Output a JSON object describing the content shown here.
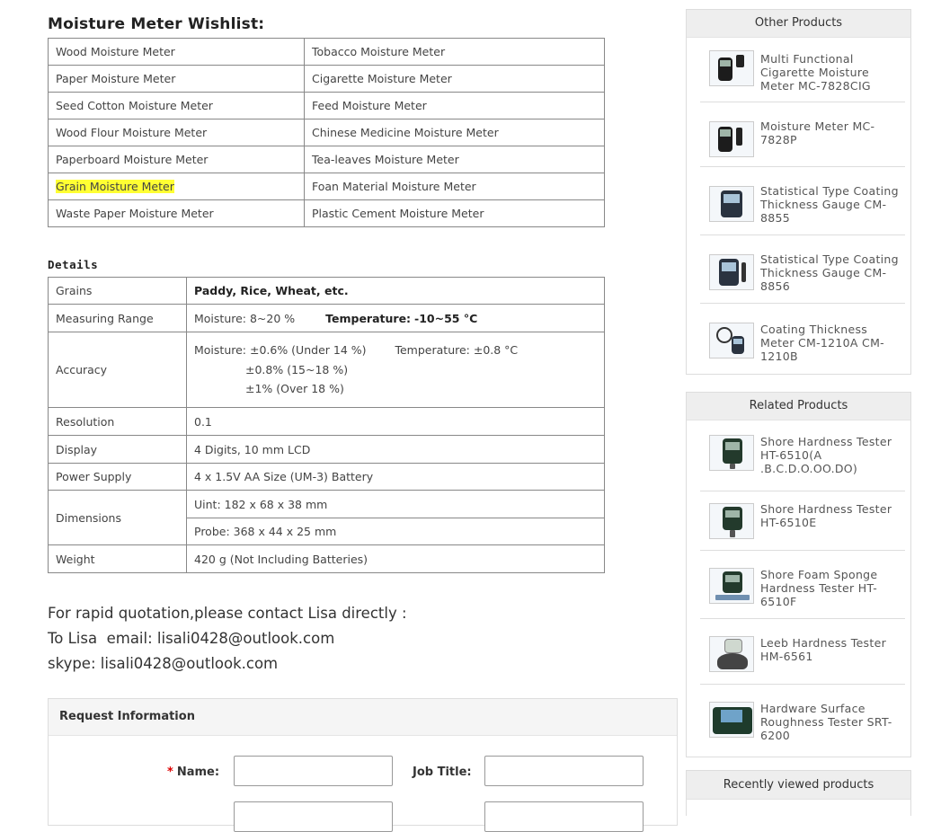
{
  "wishlist": {
    "title": "Moisture Meter Wishlist:",
    "rows": [
      [
        "Wood Moisture Meter",
        "Tobacco Moisture Meter"
      ],
      [
        "Paper Moisture Meter",
        "Cigarette Moisture Meter"
      ],
      [
        "Seed Cotton Moisture Meter",
        "Feed Moisture Meter"
      ],
      [
        "Wood Flour Moisture Meter",
        "Chinese Medicine Moisture Meter"
      ],
      [
        "Paperboard Moisture Meter",
        "Tea-leaves Moisture Meter"
      ],
      [
        "Grain Moisture Meter",
        "Foan Material Moisture Meter"
      ],
      [
        "Waste Paper Moisture Meter",
        "Plastic Cement Moisture Meter"
      ]
    ],
    "highlight_color": "#ffff33"
  },
  "details": {
    "title": "Details",
    "grains_label": "Grains",
    "grains_value": "Paddy, Rice, Wheat, etc.",
    "range_label": "Measuring Range",
    "range_moisture": "Moisture: 8~20 %",
    "range_temp_label": "Temperature:",
    "range_temp_value": "-10~55 °C",
    "accuracy_label": "Accuracy",
    "accuracy_line1": "Moisture: ±0.6% (Under 14 %)",
    "accuracy_temp": "Temperature: ±0.8 °C",
    "accuracy_line2": "±0.8% (15~18 %)",
    "accuracy_line3": "±1% (Over 18 %)",
    "resolution_label": "Resolution",
    "resolution_value": "0.1",
    "display_label": "Display",
    "display_value": "4 Digits, 10 mm LCD",
    "power_label": "Power Supply",
    "power_value": "4 x 1.5V AA Size (UM-3) Battery",
    "dimensions_label": "Dimensions",
    "dimensions_unit": "Uint: 182 x 68 x 38 mm",
    "dimensions_probe": "Probe: 368 x 44 x 25 mm",
    "weight_label": "Weight",
    "weight_value": "420 g (Not Including Batteries)"
  },
  "contact": {
    "line1": "For rapid quotation,please contact Lisa directly :",
    "line2": "To Lisa  email: lisali0428@outlook.com",
    "line3": "skype: lisali0428@outlook.com"
  },
  "request": {
    "title": "Request Information",
    "required_mark": "*",
    "name_label": "Name:",
    "job_title_label": "Job Title:"
  },
  "other_products": {
    "title": "Other Products",
    "items": [
      {
        "name": "Multi Functional Cigarette Moisture Meter MC-7828CIG"
      },
      {
        "name": "Moisture Meter MC-7828P"
      },
      {
        "name": "Statistical Type Coating Thickness Gauge CM-8855"
      },
      {
        "name": "Statistical Type Coating Thickness Gauge CM-8856"
      },
      {
        "name": "Coating Thickness Meter CM-1210A CM-1210B"
      }
    ]
  },
  "related_products": {
    "title": "Related Products",
    "items": [
      {
        "name": "Shore Hardness Tester HT-6510(A .B.C.D.O.OO.DO)"
      },
      {
        "name": "Shore Hardness Tester HT-6510E"
      },
      {
        "name": "Shore Foam Sponge Hardness Tester HT-6510F"
      },
      {
        "name": "Leeb Hardness Tester HM-6561"
      },
      {
        "name": "Hardware Surface Roughness Tester SRT-6200"
      }
    ]
  },
  "recently_viewed": {
    "title": "Recently viewed products"
  }
}
